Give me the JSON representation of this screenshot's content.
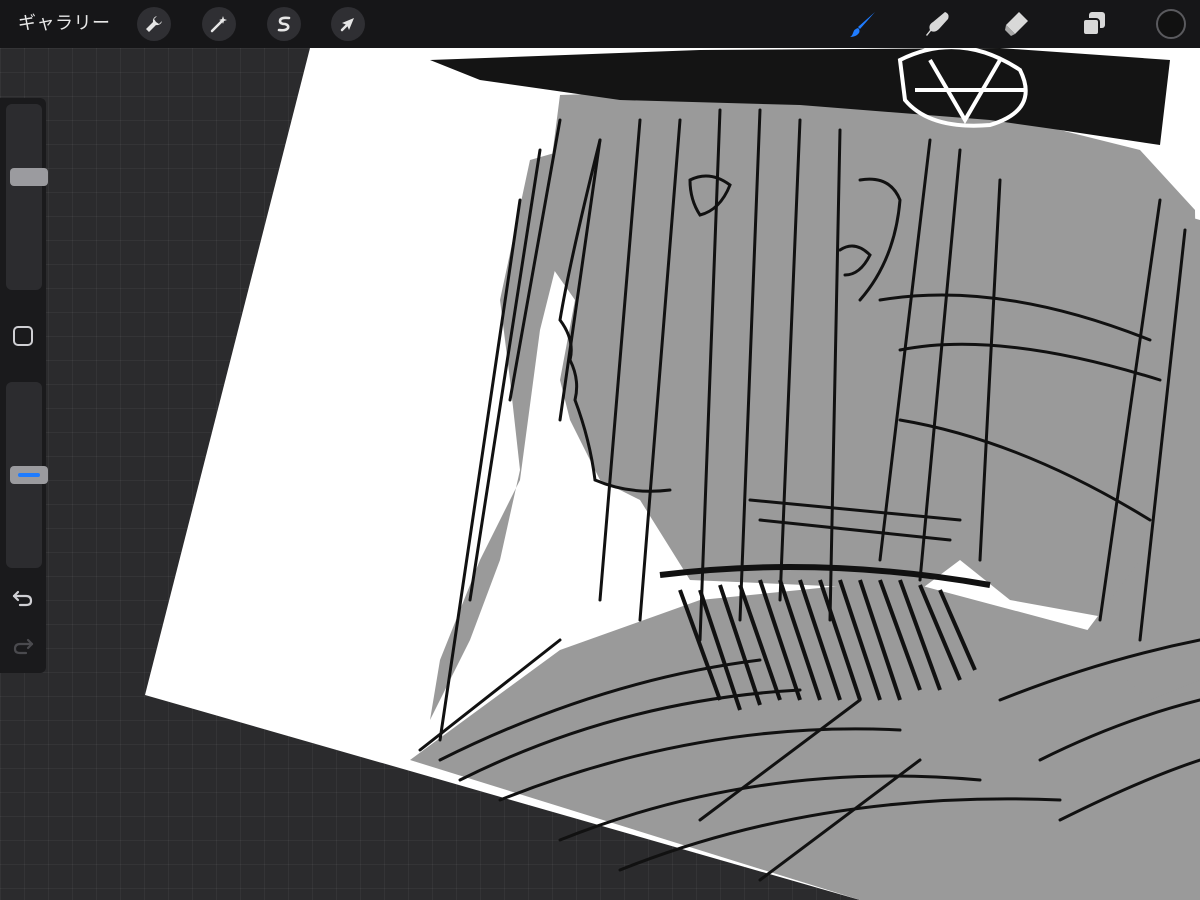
{
  "app": {
    "gallery_label": "ギャラリー"
  },
  "toolbar": {
    "left_tools": [
      {
        "name": "actions",
        "icon": "wrench-icon"
      },
      {
        "name": "adjustments",
        "icon": "magic-wand-icon"
      },
      {
        "name": "selection",
        "icon": "selection-s-icon"
      },
      {
        "name": "transform",
        "icon": "arrow-cursor-icon"
      }
    ],
    "right_tools": [
      {
        "name": "brush",
        "icon": "brush-icon",
        "active": true
      },
      {
        "name": "smudge",
        "icon": "smudge-finger-icon",
        "active": false
      },
      {
        "name": "eraser",
        "icon": "eraser-icon",
        "active": false
      },
      {
        "name": "layers",
        "icon": "layers-icon",
        "active": false
      }
    ],
    "current_color": "#111111"
  },
  "sidebar": {
    "brush_size_level": 0.62,
    "brush_opacity_level": 0.5,
    "modify_icon": "square-modify-icon",
    "undo_icon": "undo-arrow-icon",
    "redo_icon": "redo-arrow-icon",
    "redo_enabled": false
  },
  "colors": {
    "accent": "#1f7cff",
    "toolbar_bg": "#161618",
    "canvas_paper": "#ffffff",
    "sketch_fill": "#9a9a9a",
    "ink": "#111111"
  }
}
